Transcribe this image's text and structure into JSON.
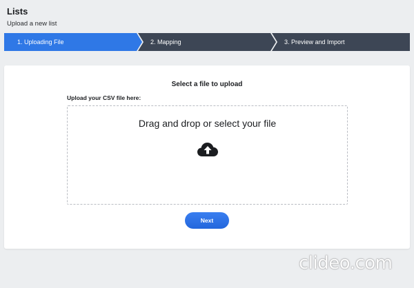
{
  "header": {
    "title": "Lists",
    "subtitle": "Upload a new list"
  },
  "stepper": {
    "steps": [
      {
        "label": "1. Uploading File",
        "active": true
      },
      {
        "label": "2. Mapping",
        "active": false
      },
      {
        "label": "3. Preview and Import",
        "active": false
      }
    ],
    "active_color": "#2f78e6",
    "inactive_color": "#3d4655",
    "separator_color": "#ffffff"
  },
  "card": {
    "heading": "Select a file to upload",
    "upload_label": "Upload your CSV file here:",
    "dropzone_text": "Drag and drop or select your file",
    "dropzone_icon": "cloud-upload-icon",
    "next_label": "Next"
  },
  "colors": {
    "background": "#eceef0",
    "card": "#ffffff",
    "button": "#2f74e8",
    "text": "#1b1d20"
  },
  "watermark": {
    "text": "clideo.com"
  }
}
